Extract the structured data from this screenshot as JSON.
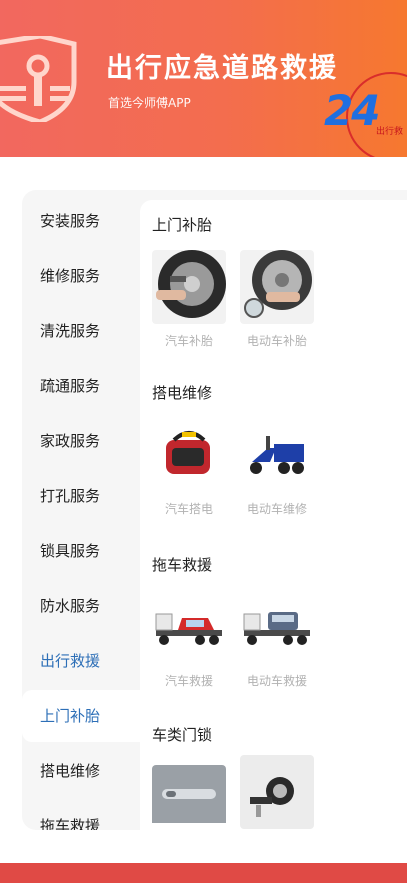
{
  "banner": {
    "title": "出行应急道路救援",
    "subtitle": "首选今师傅APP",
    "badge_number": "24",
    "badge_text": "出行救",
    "logo_icon": "shield-logo-icon"
  },
  "categories": [
    {
      "label": "安装服务"
    },
    {
      "label": "维修服务"
    },
    {
      "label": "清洗服务"
    },
    {
      "label": "疏通服务"
    },
    {
      "label": "家政服务"
    },
    {
      "label": "打孔服务"
    },
    {
      "label": "锁具服务"
    },
    {
      "label": "防水服务"
    },
    {
      "label": "出行救援"
    },
    {
      "label": "上门补胎"
    },
    {
      "label": "搭电维修"
    },
    {
      "label": "拖车救援"
    }
  ],
  "sections": [
    {
      "title": "上门补胎",
      "items": [
        {
          "label": "汽车补胎",
          "icon": "car-tire-repair-icon"
        },
        {
          "label": "电动车补胎",
          "icon": "ebike-tire-repair-icon"
        }
      ]
    },
    {
      "title": "搭电维修",
      "items": [
        {
          "label": "汽车搭电",
          "icon": "jump-starter-icon"
        },
        {
          "label": "电动车维修",
          "icon": "electric-tricycle-icon"
        }
      ]
    },
    {
      "title": "拖车救援",
      "items": [
        {
          "label": "汽车救援",
          "icon": "tow-truck-car-icon"
        },
        {
          "label": "电动车救援",
          "icon": "tow-truck-ebike-icon"
        }
      ]
    },
    {
      "title": "车类门锁",
      "items": [
        {
          "label": "",
          "icon": "car-door-handle-icon"
        },
        {
          "label": "",
          "icon": "ignition-lock-icon"
        }
      ]
    }
  ],
  "colors": {
    "banner_start": "#f2685f",
    "banner_end": "#f6782f",
    "active_text": "#2d6fb7",
    "bottom_bar": "#e04a45"
  }
}
